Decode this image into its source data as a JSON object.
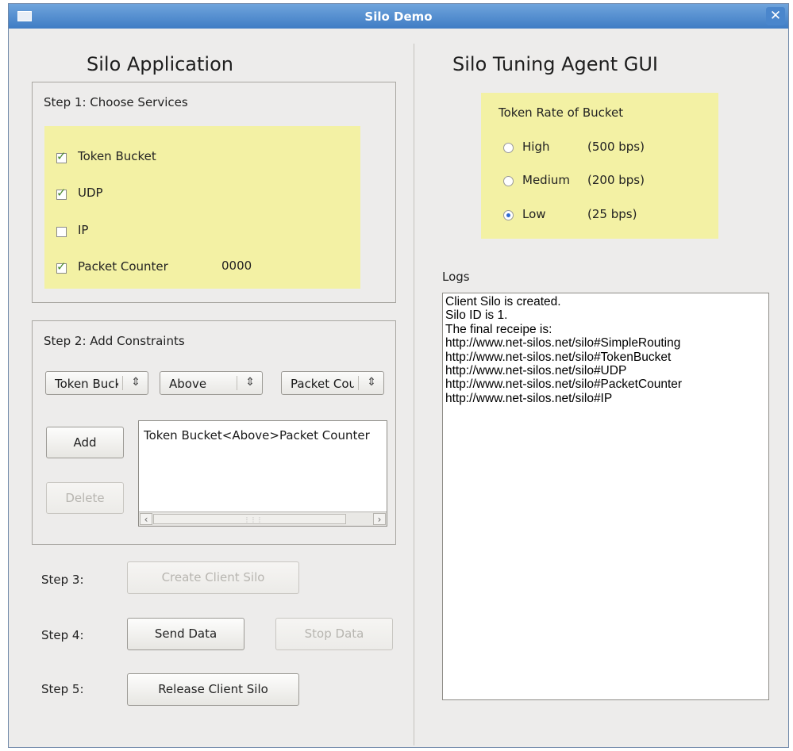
{
  "window": {
    "title": "Silo Demo",
    "close": "✕"
  },
  "left": {
    "heading": "Silo Application",
    "step1": {
      "title": "Step 1: Choose Services",
      "items": [
        {
          "label": "Token Bucket",
          "checked": true
        },
        {
          "label": "UDP",
          "checked": true
        },
        {
          "label": "IP",
          "checked": false
        },
        {
          "label": "Packet Counter",
          "checked": true
        }
      ],
      "counter_value": "0000"
    },
    "step2": {
      "title": "Step 2: Add Constraints",
      "combo1": "Token Bucket",
      "combo2": "Above",
      "combo3": "Packet Counter",
      "add_label": "Add",
      "delete_label": "Delete",
      "constraints": [
        "Token Bucket<Above>Packet Counter"
      ]
    },
    "step3": {
      "label": "Step 3:",
      "button": "Create Client Silo"
    },
    "step4": {
      "label": "Step 4:",
      "send_button": "Send Data",
      "stop_button": "Stop Data"
    },
    "step5": {
      "label": "Step 5:",
      "button": "Release Client Silo"
    }
  },
  "right": {
    "heading": "Silo Tuning Agent GUI",
    "token_rate": {
      "title": "Token Rate of Bucket",
      "options": [
        {
          "label": "High",
          "rate": "(500 bps)",
          "selected": false
        },
        {
          "label": "Medium",
          "rate": "(200 bps)",
          "selected": false
        },
        {
          "label": "Low",
          "rate": "(25 bps)",
          "selected": true
        }
      ]
    },
    "logs_label": "Logs",
    "logs_text": "Client Silo is created.\nSilo ID is 1.\nThe final receipe is:\nhttp://www.net-silos.net/silo#SimpleRouting\nhttp://www.net-silos.net/silo#TokenBucket\nhttp://www.net-silos.net/silo#UDP\nhttp://www.net-silos.net/silo#PacketCounter\nhttp://www.net-silos.net/silo#IP"
  },
  "colors": {
    "titlebar": "#4f8ed2",
    "window_bg": "#edeceb",
    "highlight_yellow": "#f3f1a4",
    "check_green": "#4a8a2e",
    "radio_blue": "#2f6ad3"
  }
}
